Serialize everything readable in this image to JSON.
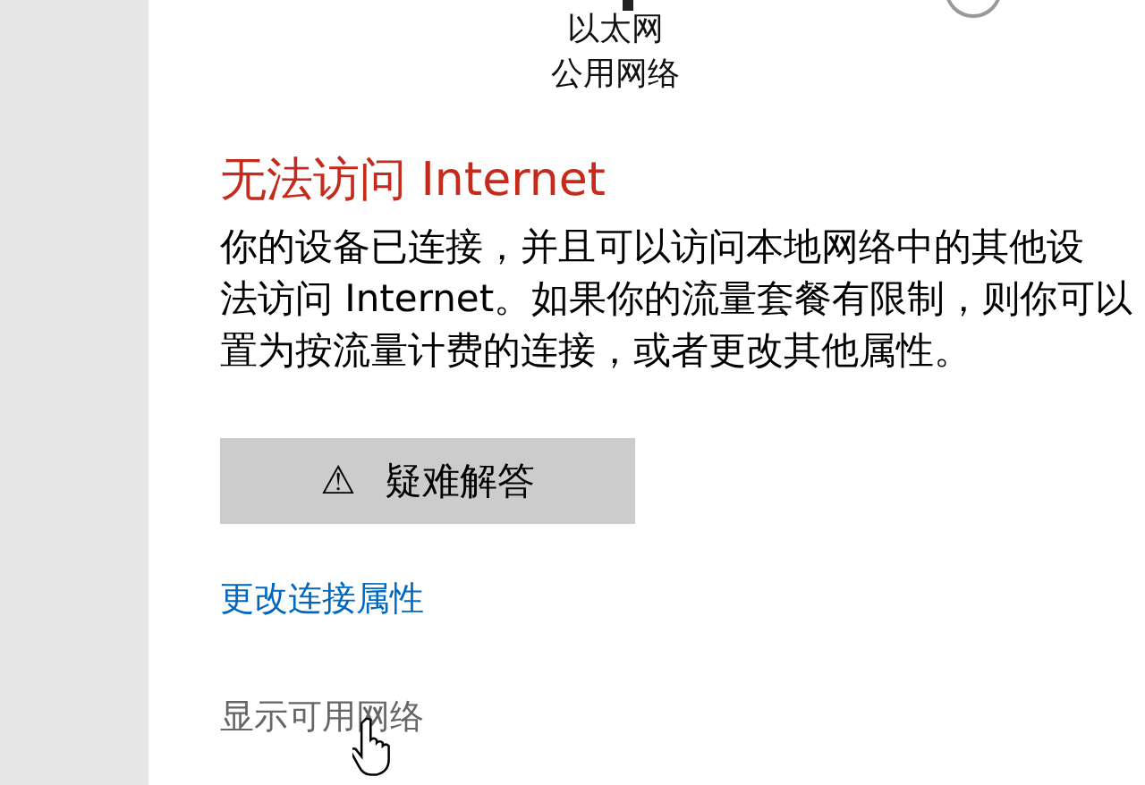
{
  "network": {
    "name": "以太网",
    "profile": "公用网络"
  },
  "status": {
    "title": "无法访问 Internet",
    "lines": [
      "你的设备已连接，并且可以访问本地网络中的其他设",
      "法访问 Internet。如果你的流量套餐有限制，则你可以",
      "置为按流量计费的连接，或者更改其他属性。"
    ]
  },
  "troubleshoot_button": {
    "icon": "⚠",
    "label": "疑难解答"
  },
  "links": [
    {
      "label": "更改连接属性",
      "kind": "link"
    },
    {
      "label": "显示可用网络",
      "kind": "plain"
    }
  ]
}
